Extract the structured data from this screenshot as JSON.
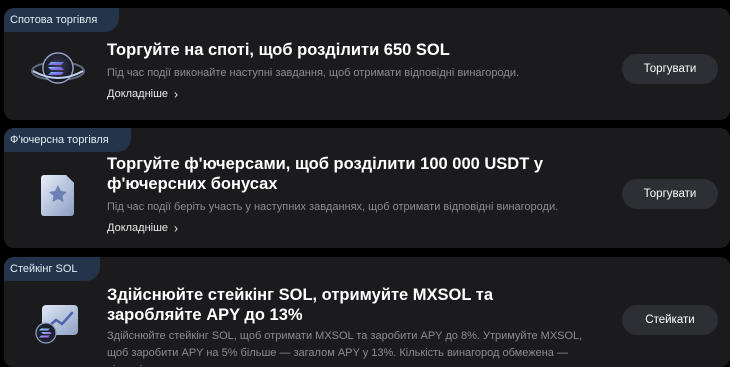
{
  "cards": [
    {
      "tag": "Спотова торгівля",
      "title": "Торгуйте на споті, щоб розділити 650 SOL",
      "description": "Під час події виконайте наступні завдання, щоб отримати відповідні винагороди.",
      "more": "Докладніше",
      "button": "Торгувати"
    },
    {
      "tag": "Ф'ючерсна торгівля",
      "title": "Торгуйте ф'ючерсами, щоб розділити 100 000 USDT у ф'ючерсних бонусах",
      "description": "Під час події беріть участь у наступних завданнях, щоб отримати відповідні винагороди.",
      "more": "Докладніше",
      "button": "Торгувати"
    },
    {
      "tag": "Стейкінг SOL",
      "title": "Здійснюйте стейкінг SOL, отримуйте MXSOL та заробляйте APY до 13%",
      "description": "Здійснюйте стейкінг SOL, щоб отримати MXSOL та заробити APY до 8%. Утримуйте MXSOL, щоб заробити APY на 5% більше — загалом APY у 13%. Кількість винагород обмежена — відповідно до черги.",
      "button": "Стейкати"
    }
  ]
}
